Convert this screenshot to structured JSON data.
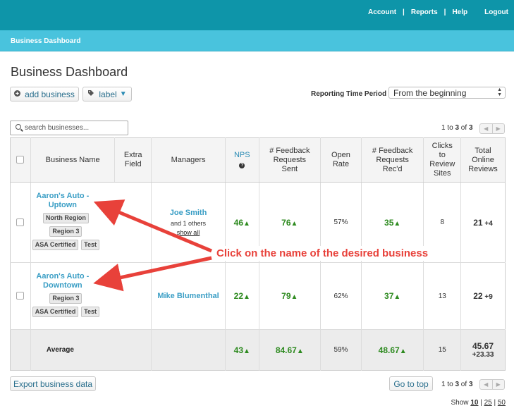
{
  "nav": {
    "account": "Account",
    "reports": "Reports",
    "help": "Help",
    "logout": "Logout",
    "separator": "|"
  },
  "subbar": {
    "title": "Business Dashboard"
  },
  "page": {
    "title": "Business Dashboard"
  },
  "toolbar": {
    "add_business": "add business",
    "label": "label",
    "reporting_label": "Reporting Time Period",
    "reporting_value": "From the beginning"
  },
  "search": {
    "placeholder": "search businesses..."
  },
  "pagination": {
    "text_start": "1",
    "text_mid": " to ",
    "text_end": "3",
    "text_of": " of ",
    "total": "3"
  },
  "table": {
    "headers": {
      "business_name": "Business Name",
      "extra_field": "Extra Field",
      "managers": "Managers",
      "nps": "NPS",
      "feedback_sent": "# Feedback Requests Sent",
      "open_rate": "Open Rate",
      "feedback_recd": "# Feedback Requests Rec'd",
      "clicks": "Clicks to Review Sites",
      "total_reviews": "Total Online Reviews"
    },
    "rows": [
      {
        "name": "Aaron's Auto - Uptown",
        "tags": [
          "North Region",
          "Region 3",
          "ASA Certified",
          "Test"
        ],
        "manager": "Joe Smith",
        "manager_others": "and 1 others",
        "show_all": "show all",
        "nps": "46",
        "feedback_sent": "76",
        "open_rate": "57%",
        "feedback_recd": "35",
        "clicks": "8",
        "total": "21",
        "delta": "+4"
      },
      {
        "name": "Aaron's Auto - Downtown",
        "tags": [
          "Region 3",
          "ASA Certified",
          "Test"
        ],
        "manager": "Mike Blumenthal",
        "nps": "22",
        "feedback_sent": "79",
        "open_rate": "62%",
        "feedback_recd": "37",
        "clicks": "13",
        "total": "22",
        "delta": "+9"
      }
    ],
    "average": {
      "label": "Average",
      "nps": "43",
      "feedback_sent": "84.67",
      "open_rate": "59%",
      "feedback_recd": "48.67",
      "clicks": "15",
      "total": "45.67",
      "delta": "+23.33"
    }
  },
  "callout": {
    "text": "Click on the name of the desired business"
  },
  "footer": {
    "export": "Export business data",
    "go_to_top": "Go to top",
    "show_label": "Show",
    "show_options": [
      "10",
      "25",
      "50"
    ]
  },
  "colors": {
    "topbar": "#0e95a9",
    "subbar": "#49c3dd",
    "link": "#3a9ec5",
    "positive": "#2d8a1f",
    "callout": "#e8413a"
  },
  "icons": {
    "add": "plus-circle-icon",
    "label": "tag-icon",
    "search": "search-icon",
    "trend": "up-triangle-icon",
    "help": "question-circle-icon"
  }
}
